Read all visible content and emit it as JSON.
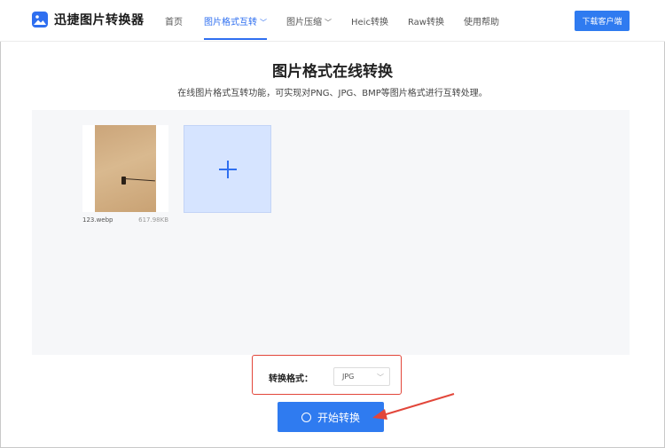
{
  "header": {
    "app_title": "迅捷图片转换器",
    "nav": [
      {
        "label": "首页",
        "active": false,
        "has_dropdown": false
      },
      {
        "label": "图片格式互转",
        "active": true,
        "has_dropdown": true
      },
      {
        "label": "图片压缩",
        "active": false,
        "has_dropdown": true
      },
      {
        "label": "Heic转换",
        "active": false,
        "has_dropdown": false
      },
      {
        "label": "Raw转换",
        "active": false,
        "has_dropdown": false
      },
      {
        "label": "使用帮助",
        "active": false,
        "has_dropdown": false
      }
    ],
    "download_button": "下载客户端"
  },
  "main": {
    "title": "图片格式在线转换",
    "subtitle": "在线图片格式互转功能，可实现对PNG、JPG、BMP等图片格式进行互转处理。"
  },
  "files": [
    {
      "name": "123.webp",
      "size": "617.98KB"
    }
  ],
  "conversion": {
    "format_label": "转换格式：",
    "selected_format": "JPG"
  },
  "start_button": "开始转换",
  "colors": {
    "accent": "#2f6ff0",
    "annotation": "#e2463a"
  }
}
